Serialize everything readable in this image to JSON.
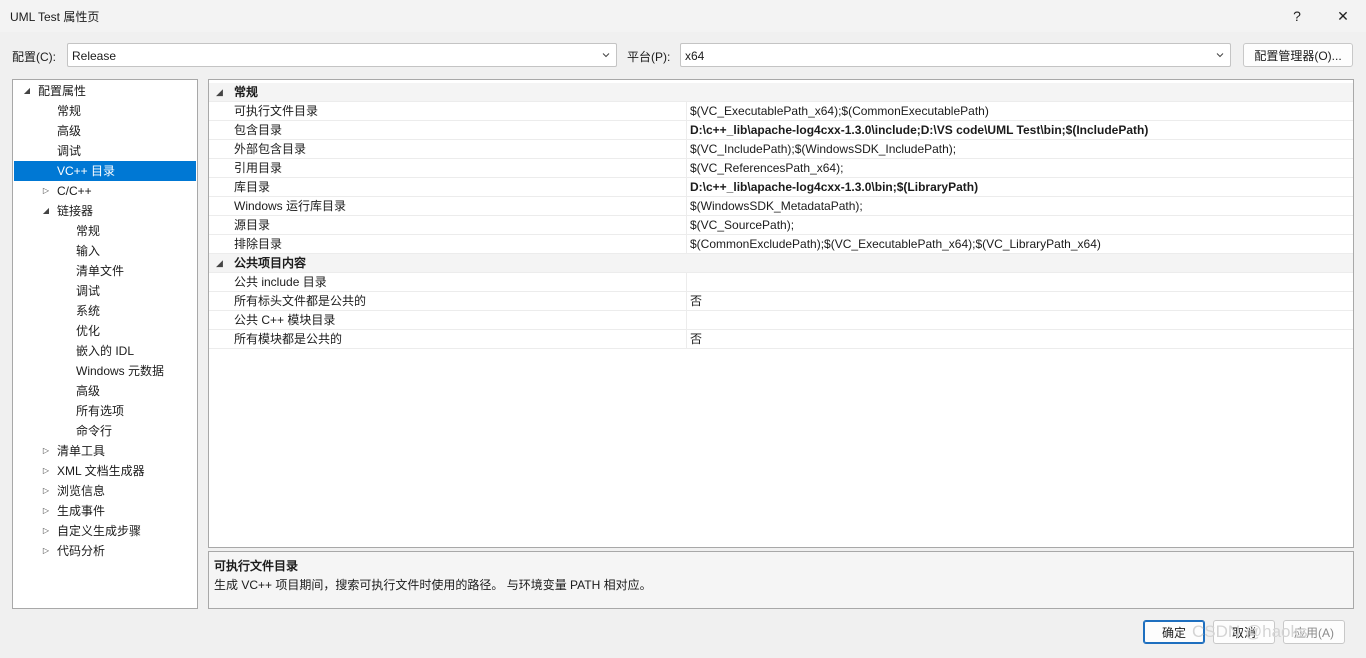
{
  "window": {
    "title": "UML Test 属性页",
    "help": "?",
    "close": "✕"
  },
  "config": {
    "label": "配置(C):",
    "value": "Release"
  },
  "platform": {
    "label": "平台(P):",
    "value": "x64"
  },
  "config_manager_label": "配置管理器(O)...",
  "tree": {
    "items": [
      {
        "label": "配置属性",
        "exp": "◢"
      },
      {
        "label": "常规"
      },
      {
        "label": "高级"
      },
      {
        "label": "调试"
      },
      {
        "label": "VC++ 目录"
      },
      {
        "label": "C/C++",
        "exp": "▷"
      },
      {
        "label": "链接器",
        "exp": "◢"
      },
      {
        "label": "常规"
      },
      {
        "label": "输入"
      },
      {
        "label": "清单文件"
      },
      {
        "label": "调试"
      },
      {
        "label": "系统"
      },
      {
        "label": "优化"
      },
      {
        "label": "嵌入的 IDL"
      },
      {
        "label": "Windows 元数据"
      },
      {
        "label": "高级"
      },
      {
        "label": "所有选项"
      },
      {
        "label": "命令行"
      },
      {
        "label": "清单工具",
        "exp": "▷"
      },
      {
        "label": "XML 文档生成器",
        "exp": "▷"
      },
      {
        "label": "浏览信息",
        "exp": "▷"
      },
      {
        "label": "生成事件",
        "exp": "▷"
      },
      {
        "label": "自定义生成步骤",
        "exp": "▷"
      },
      {
        "label": "代码分析",
        "exp": "▷"
      }
    ]
  },
  "grid": {
    "rows": [
      {
        "name": "常规",
        "exp": "◢"
      },
      {
        "name": "可执行文件目录",
        "value": "$(VC_ExecutablePath_x64);$(CommonExecutablePath)"
      },
      {
        "name": "包含目录",
        "value": "D:\\c++_lib\\apache-log4cxx-1.3.0\\include;D:\\VS code\\UML Test\\bin;$(IncludePath)"
      },
      {
        "name": "外部包含目录",
        "value": "$(VC_IncludePath);$(WindowsSDK_IncludePath);"
      },
      {
        "name": "引用目录",
        "value": "$(VC_ReferencesPath_x64);"
      },
      {
        "name": "库目录",
        "value": "D:\\c++_lib\\apache-log4cxx-1.3.0\\bin;$(LibraryPath)"
      },
      {
        "name": "Windows 运行库目录",
        "value": "$(WindowsSDK_MetadataPath);"
      },
      {
        "name": "源目录",
        "value": "$(VC_SourcePath);"
      },
      {
        "name": "排除目录",
        "value": "$(CommonExcludePath);$(VC_ExecutablePath_x64);$(VC_LibraryPath_x64)"
      },
      {
        "name": "公共项目内容",
        "exp": "◢"
      },
      {
        "name": "公共 include 目录",
        "value": ""
      },
      {
        "name": "所有标头文件都是公共的",
        "value": "否"
      },
      {
        "name": "公共 C++ 模块目录",
        "value": ""
      },
      {
        "name": "所有模块都是公共的",
        "value": "否"
      }
    ]
  },
  "description": {
    "title": "可执行文件目录",
    "text": "生成 VC++ 项目期间，搜索可执行文件时使用的路径。  与环境变量 PATH 相对应。"
  },
  "buttons": {
    "ok": "确定",
    "cancel": "取消",
    "apply": "应用(A)"
  },
  "watermark": "CSDN @haoks",
  "colors": {
    "selection": "#0078d4",
    "primary_border": "#1e6fbf"
  }
}
